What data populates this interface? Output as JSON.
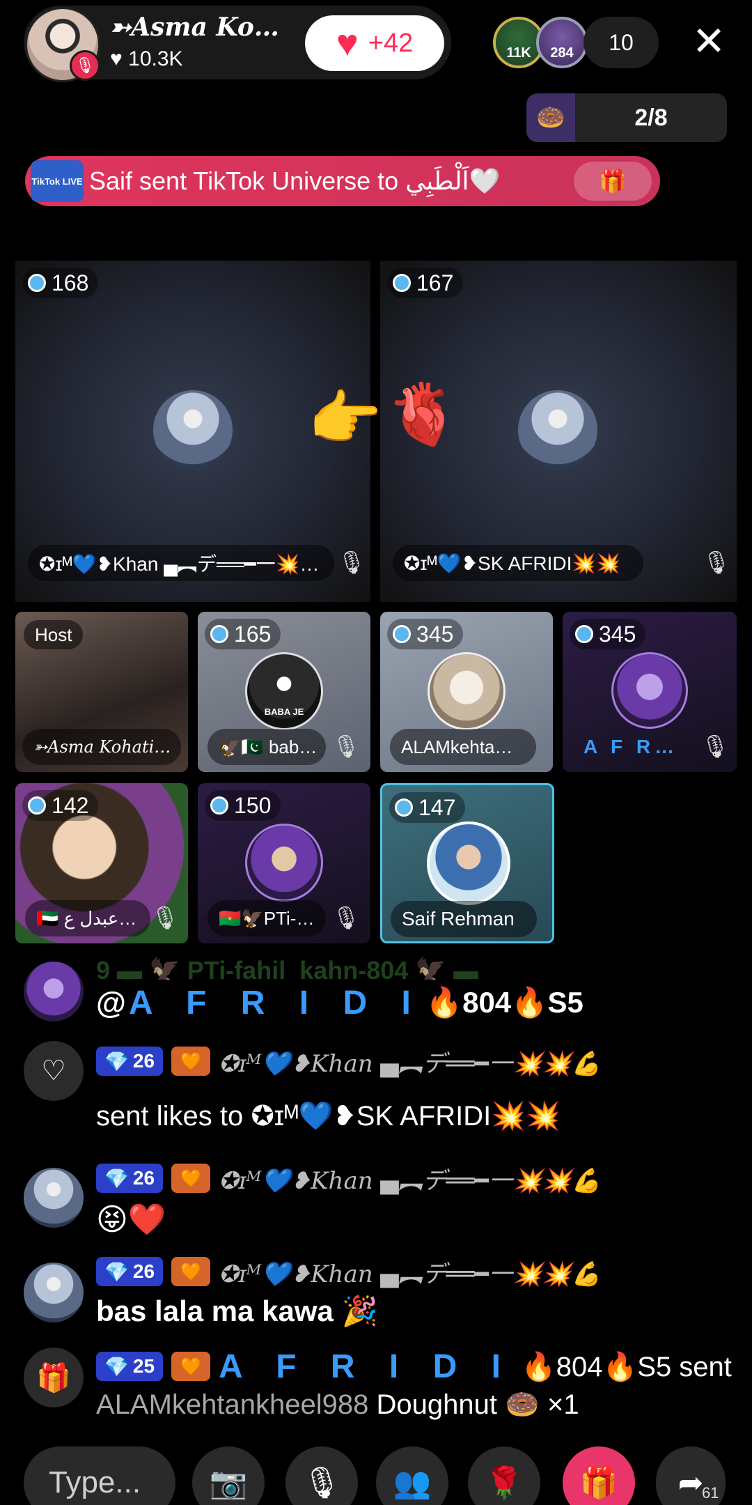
{
  "host": {
    "name": "➳Asma Ko…",
    "likes": "10.3K",
    "like_gain": "+42"
  },
  "viewers": {
    "badge_1": "11K",
    "badge_2": "284",
    "count": "10"
  },
  "round": {
    "text": "2/8"
  },
  "gift_banner": {
    "badge_text": "TikTok LIVE",
    "text": "Saif sent TikTok Universe to اَلْطَبِي🤍"
  },
  "guests": [
    {
      "score": "168",
      "name": "✪ɪᴹ💙❥Khan ▄︻デ══━一💥…"
    },
    {
      "score": "167",
      "name": "✪ɪᴹ💙❥SK AFRIDI💥💥"
    },
    {
      "tag": "Host",
      "name": "➳Asma Kohati…"
    },
    {
      "score": "165",
      "name": "🦅🇵🇰 bab…",
      "avatar_text": "BABA JE"
    },
    {
      "score": "345",
      "name": "ALAMkehta…"
    },
    {
      "score": "345",
      "name": "A F R…"
    },
    {
      "score": "142",
      "name": "🇦🇪 عبدل ع…"
    },
    {
      "score": "150",
      "name": "🇧🇫🦅PTi-…"
    },
    {
      "score": "147",
      "name": "Saif Rehman"
    }
  ],
  "floating": {
    "left": "👉",
    "right": "🫀"
  },
  "chat": {
    "faded_line": "9 ▬ 🦅 PTi-fahil_kahn-804 🦅 ▬",
    "line1_handle": "@",
    "line1_afridi": "A F R I D I",
    "line1_suffix": "🔥804🔥S5",
    "msg2_level": "26",
    "msg2_user": "✪ɪᴹ💙❥Khan ▄︻デ══━一💥💥💪",
    "msg2_text": "sent likes to ✪ɪᴹ💙❥SK AFRIDI💥💥",
    "msg3_level": "26",
    "msg3_user": "✪ɪᴹ💙❥Khan ▄︻デ══━一💥💥💪",
    "msg3_text": "😝❤️",
    "msg4_level": "26",
    "msg4_user": "✪ɪᴹ💙❥Khan ▄︻デ══━一💥💥💪",
    "msg4_text": "bas lala ma kawa 🎉",
    "msg5_level": "25",
    "msg5_afridi": "A F R I D I",
    "msg5_suffix": "🔥804🔥S5 sent",
    "msg5_recipient": "ALAMkehtankheel988",
    "msg5_gift": "Doughnut 🍩 ×1"
  },
  "toolbar": {
    "type_placeholder": "Type...",
    "share_count": "61"
  },
  "colors": {
    "accent": "#fe2c55",
    "afridi_blue": "#3a9bff",
    "level_badge": "#2b3fc9"
  }
}
